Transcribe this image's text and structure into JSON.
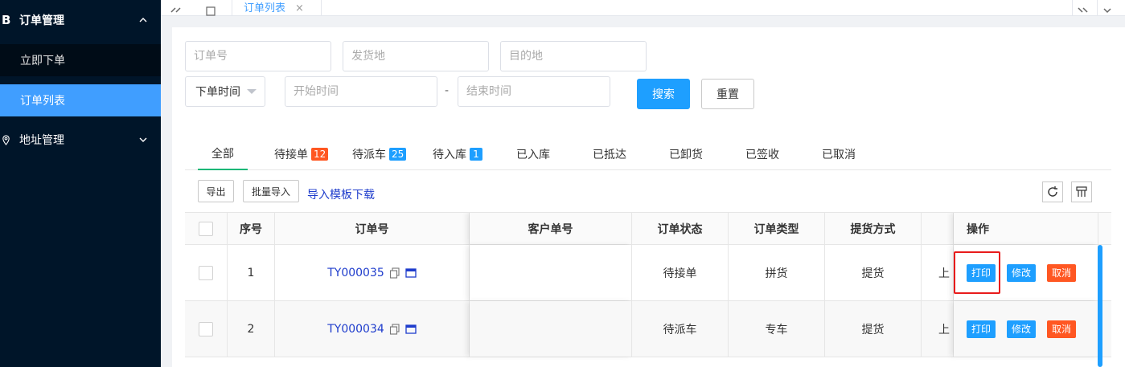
{
  "sidebar": {
    "logo_letter": "B",
    "groups": [
      {
        "label": "订单管理",
        "items": [
          {
            "label": "立即下单"
          },
          {
            "label": "订单列表"
          }
        ]
      },
      {
        "label": "地址管理"
      }
    ]
  },
  "topbar": {
    "tab_label": "订单列表",
    "tab_close": "×"
  },
  "search": {
    "order_no_placeholder": "订单号",
    "origin_placeholder": "发货地",
    "destination_placeholder": "目的地",
    "time_type_value": "下单时间",
    "start_time_placeholder": "开始时间",
    "range_separator": "-",
    "end_time_placeholder": "结束时间",
    "search_label": "搜索",
    "reset_label": "重置"
  },
  "status_tabs": [
    {
      "label": "全部"
    },
    {
      "label": "待接单",
      "badge": "12",
      "badge_color": "#ff5722"
    },
    {
      "label": "待派车",
      "badge": "25",
      "badge_color": "#1e9fff"
    },
    {
      "label": "待入库",
      "badge": "1",
      "badge_color": "#1e9fff"
    },
    {
      "label": "已入库"
    },
    {
      "label": "已抵达"
    },
    {
      "label": "已卸货"
    },
    {
      "label": "已签收"
    },
    {
      "label": "已取消"
    }
  ],
  "toolbar": {
    "export_label": "导出",
    "import_label": "批量导入",
    "template_link": "导入模板下载",
    "refresh_icon": "refresh-icon",
    "columns_icon": "columns-icon"
  },
  "table": {
    "headers": {
      "index": "序号",
      "order_no": "订单号",
      "customer_no": "客户单号",
      "status": "订单状态",
      "type": "订单类型",
      "pickup": "提货方式",
      "actions": "操作"
    },
    "rows": [
      {
        "index": "1",
        "order_no": "TY000035",
        "customer_no": "",
        "status": "待接单",
        "type": "拼货",
        "pickup": "提货",
        "truncated": "上"
      },
      {
        "index": "2",
        "order_no": "TY000034",
        "customer_no": "",
        "status": "待派车",
        "type": "专车",
        "pickup": "提货",
        "truncated": "上"
      }
    ],
    "action_labels": {
      "print": "打印",
      "edit": "修改",
      "cancel": "取消"
    }
  }
}
